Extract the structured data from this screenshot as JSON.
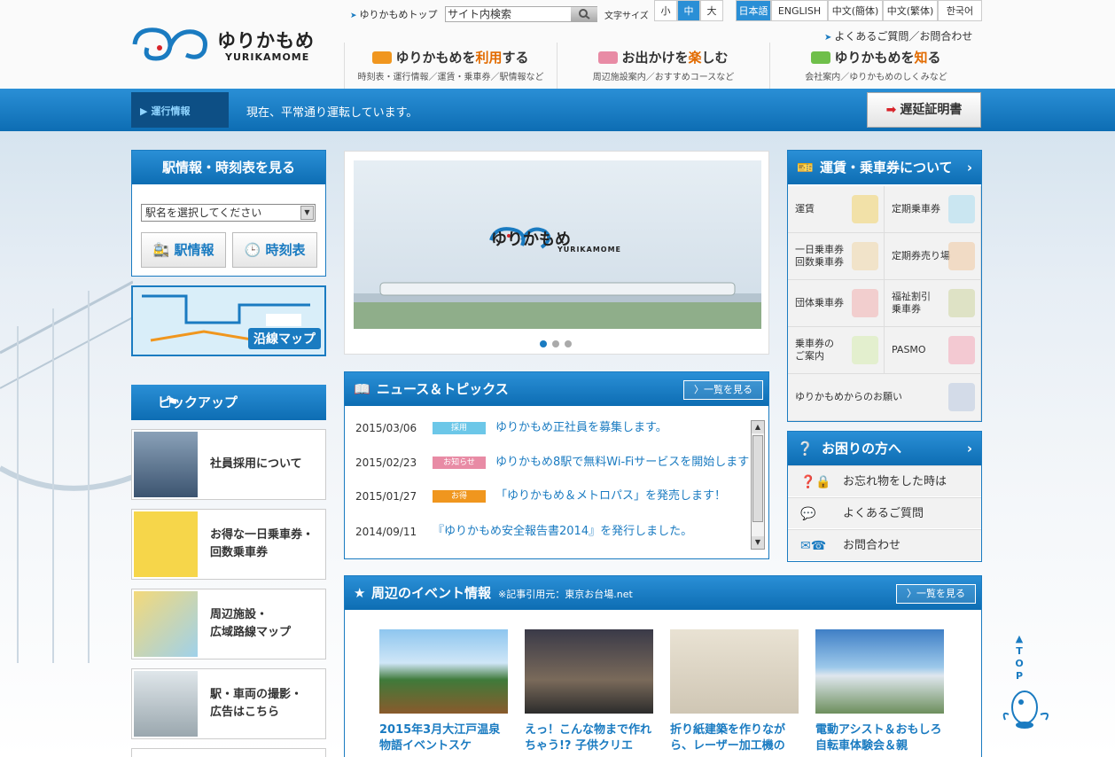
{
  "header": {
    "logo_text": "ゆりかもめ",
    "logo_sub": "YURIKAMOME",
    "top_link": "ゆりかもめトップ",
    "search_placeholder": "サイト内検索",
    "font_size_label": "文字サイズ",
    "font_sizes": [
      "小",
      "中",
      "大"
    ],
    "languages": [
      "日本語",
      "ENGLISH",
      "中文(簡体)",
      "中文(繁体)",
      "한국어"
    ],
    "faq_link": "よくあるご質問／お問合わせ",
    "nav": [
      {
        "title_pre": "ゆりかもめを",
        "title_em": "利用",
        "title_post": "する",
        "sub": "時刻表・運行情報／運賃・乗車券／駅情報など"
      },
      {
        "title_pre": "お出かけを",
        "title_em": "楽",
        "title_post": "しむ",
        "sub": "周辺施設案内／おすすめコースなど"
      },
      {
        "title_pre": "ゆりかもめを",
        "title_em": "知",
        "title_post": "る",
        "sub": "会社案内／ゆりかもめのしくみなど"
      }
    ]
  },
  "operation": {
    "label": "運行情報",
    "status": "現在、平常通り運転しています。",
    "delay_button": "遅延証明書"
  },
  "station": {
    "title": "駅情報・時刻表を見る",
    "select_default": "駅名を選択してください",
    "btn_station": "駅情報",
    "btn_timetable": "時刻表"
  },
  "route_map": {
    "label": "沿線マップ"
  },
  "pickup": {
    "title": "ピックアップ",
    "items": [
      "社員採用について",
      "お得な一日乗車券・\n回数乗車券",
      "周辺施設・\n広域路線マップ",
      "駅・車両の撮影・\n広告はこちら"
    ]
  },
  "slider": {
    "logo_text": "ゆりかもめ",
    "logo_sub": "YURIKAMOME",
    "slide_count": 3,
    "active": 1
  },
  "news": {
    "title": "ニュース＆トピックス",
    "more": "一覧を見る",
    "items": [
      {
        "date": "2015/03/06",
        "tag": "採用",
        "tag_color": "#6cc7e8",
        "text": "ゆりかもめ正社員を募集します。"
      },
      {
        "date": "2015/02/23",
        "tag": "お知らせ",
        "tag_color": "#e88ba5",
        "text": "ゆりかもめ8駅で無料Wi-Fiサービスを開始します"
      },
      {
        "date": "2015/01/27",
        "tag": "お得",
        "tag_color": "#f0961e",
        "text": "「ゆりかもめ＆メトロパス」を発売します！"
      },
      {
        "date": "2014/09/11",
        "tag": "",
        "tag_color": "",
        "text": "『ゆりかもめ安全報告書2014』を発行しました。"
      }
    ]
  },
  "events": {
    "title": "周辺のイベント情報",
    "source": "※記事引用元：東京お台場.net",
    "more": "一覧を見る",
    "items": [
      "2015年3月大江戸温泉物語イベントスケ",
      "えっ！こんな物まで作れちゃう!? 子供クリエ",
      "折り紙建築を作りながら、レーザー加工機の",
      "電動アシスト＆おもしろ自転車体験会＆親"
    ]
  },
  "fare": {
    "title": "運賃・乗車券について",
    "cells": [
      "運賃",
      "定期乗車券",
      "一日乗車券\n回数乗車券",
      "定期券売り場",
      "団体乗車券",
      "福祉割引\n乗車券",
      "乗車券の\nご案内",
      "PASMO",
      "ゆりかもめからのお願い"
    ]
  },
  "help": {
    "title": "お困りの方へ",
    "items": [
      "お忘れ物をした時は",
      "よくあるご質問",
      "お問合わせ"
    ]
  },
  "totop": "TOP",
  "colors": {
    "brand_blue": "#1a7bc1",
    "dark_blue": "#0d4f85",
    "accent_orange": "#e26b00"
  }
}
